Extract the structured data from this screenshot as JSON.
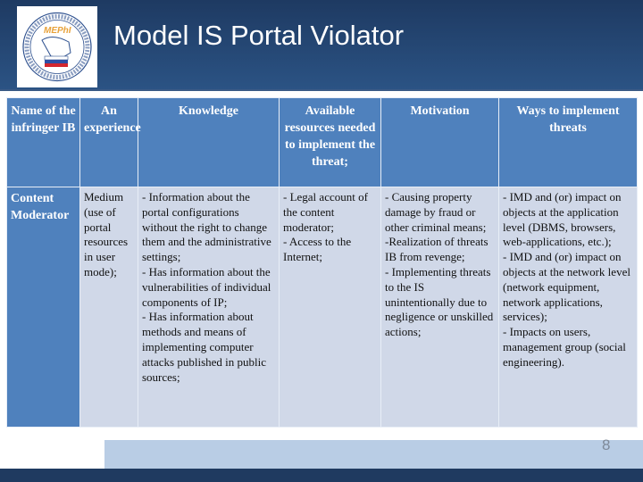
{
  "header": {
    "title": "Model IS Portal Violator",
    "logo": {
      "name": "MEPhI",
      "ring_text": "NATIONAL RESEARCH NUCLEAR UNIVERSITY • MOSCOW ENGINEERING PHYSICS INSTITUTE • MEPhI •"
    }
  },
  "table": {
    "headers": [
      "Name of the infringer IB",
      "An experience",
      "Knowledge",
      "Available resources needed to implement the threat;",
      "Motivation",
      "Ways to implement threats"
    ],
    "rows": [
      {
        "name": "Content Moderator",
        "experience": "Medium (use of portal resources in user mode);",
        "knowledge": [
          "- Information about the portal configurations without the right to change them and the administrative settings;",
          "- Has information about the vulnerabilities of individual components of IP;",
          "- Has information about methods and means of implementing computer attacks published in public sources;"
        ],
        "resources": [
          "- Legal account of the content moderator;",
          "- Access to the Internet;"
        ],
        "motivation": [
          "- Causing property damage by fraud or other criminal means;",
          "-Realization of threats IB from revenge;",
          "- Implementing threats to the IS unintentionally due to negligence or unskilled actions;"
        ],
        "ways": [
          "- IMD and (or) impact on objects at the application level (DBMS, browsers, web-applications, etc.);",
          "- IMD and (or) impact on objects at the network level (network equipment, network applications, services);",
          "- Impacts on users, management group (social engineering)."
        ]
      }
    ]
  },
  "footer": {
    "page_number": "8"
  },
  "colors": {
    "header_bg": "#1e3a62",
    "table_header": "#4f81bd",
    "table_cell": "#d0d8e8",
    "footer_band": "#b9cde5"
  }
}
